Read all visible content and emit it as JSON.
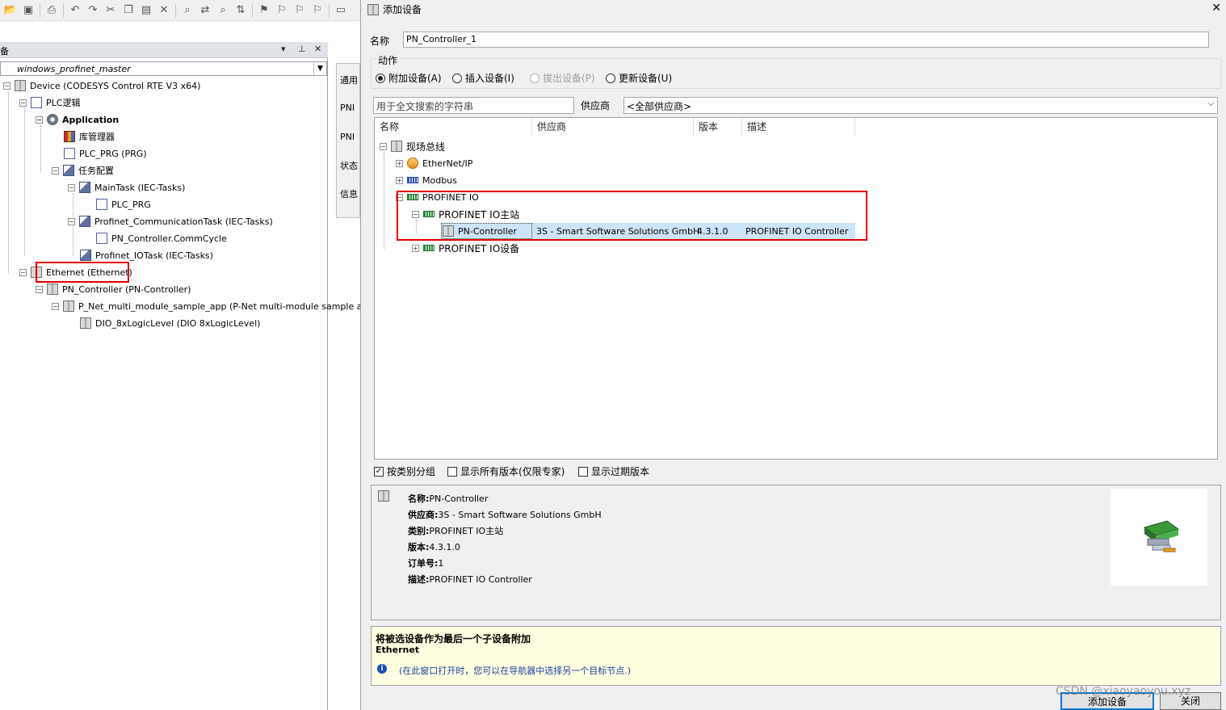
{
  "device_panel": {
    "title": "备",
    "project": "windows_profinet_master",
    "tree": [
      {
        "label": "Device (CODESYS Control RTE V3 x64)",
        "icon": "device-icon"
      },
      {
        "label": "PLC逻辑",
        "icon": "plc-logic-icon"
      },
      {
        "label": "Application",
        "icon": "gear-icon"
      },
      {
        "label": "库管理器",
        "icon": "library-icon"
      },
      {
        "label": "PLC_PRG (PRG)",
        "icon": "document-icon"
      },
      {
        "label": "任务配置",
        "icon": "task-config-icon"
      },
      {
        "label": "MainTask (IEC-Tasks)",
        "icon": "task-icon"
      },
      {
        "label": "PLC_PRG",
        "icon": "program-call-icon"
      },
      {
        "label": "Profinet_CommunicationTask (IEC-Tasks)",
        "icon": "task-icon"
      },
      {
        "label": "PN_Controller.CommCycle",
        "icon": "program-call-icon"
      },
      {
        "label": "Profinet_IOTask (IEC-Tasks)",
        "icon": "task-icon"
      },
      {
        "label": "Ethernet (Ethernet)",
        "icon": "device-icon"
      },
      {
        "label": "PN_Controller (PN-Controller)",
        "icon": "device-icon"
      },
      {
        "label": "P_Net_multi_module_sample_app (P-Net multi-module sample ap",
        "icon": "device-icon"
      },
      {
        "label": "DIO_8xLogicLevel (DIO 8xLogicLevel)",
        "icon": "device-icon"
      }
    ]
  },
  "side_tabs": [
    "通用",
    "PNI",
    "PNI",
    "状态",
    "信息"
  ],
  "dialog": {
    "title": "添加设备",
    "name_label": "名称",
    "name_value": "PN_Controller_1",
    "action_label": "动作",
    "actions": [
      {
        "label": "附加设备(A)",
        "selected": true,
        "enabled": true
      },
      {
        "label": "插入设备(I)",
        "selected": false,
        "enabled": true
      },
      {
        "label": "拔出设备(P)",
        "selected": false,
        "enabled": false
      },
      {
        "label": "更新设备(U)",
        "selected": false,
        "enabled": true
      }
    ],
    "search_placeholder": "用于全文搜索的字符串",
    "vendor_label": "供应商",
    "vendor_value": "<全部供应商>",
    "columns": [
      "名称",
      "供应商",
      "版本",
      "描述"
    ],
    "list": [
      {
        "label": "现场总线"
      },
      {
        "label": "EtherNet/IP"
      },
      {
        "label": "Modbus"
      },
      {
        "label": "PROFINET IO"
      },
      {
        "label": "PROFINET IO主站"
      },
      {
        "label": "PN-Controller",
        "vendor": "3S - Smart Software Solutions GmbH",
        "version": "4.3.1.0",
        "description": "PROFINET IO Controller"
      },
      {
        "label": "PROFINET IO设备"
      }
    ],
    "options": [
      {
        "label": "按类别分组",
        "checked": true
      },
      {
        "label": "显示所有版本(仅限专家)",
        "checked": false
      },
      {
        "label": "显示过期版本",
        "checked": false
      }
    ],
    "info": {
      "name_key": "名称:",
      "name_val": "PN-Controller",
      "vendor_key": "供应商:",
      "vendor_val": "3S - Smart Software Solutions GmbH",
      "category_key": "类别:",
      "category_val": "PROFINET IO主站",
      "version_key": "版本:",
      "version_val": "4.3.1.0",
      "order_key": "订单号:",
      "order_val": "1",
      "desc_key": "描述:",
      "desc_val": "PROFINET IO Controller"
    },
    "hint": {
      "line1": "将被选设备作为最后一个子设备附加",
      "line2": "Ethernet",
      "line3": "(在此窗口打开时，您可以在导航器中选择另一个目标节点.)"
    },
    "add_button": "添加设备",
    "close_button": "关闭"
  },
  "watermark": "CSDN @xiaoyaoyou.xyz"
}
